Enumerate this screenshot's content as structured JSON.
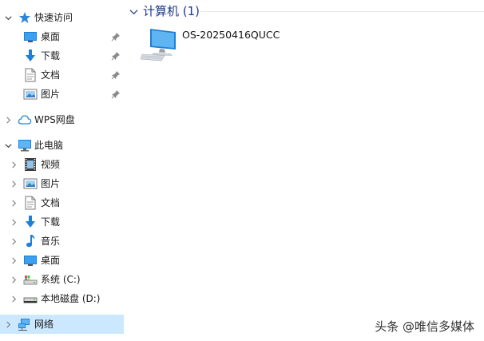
{
  "sidebar": {
    "quick_access": {
      "label": "快速访问",
      "items": [
        {
          "label": "桌面",
          "icon": "desktop-icon",
          "pinned": true
        },
        {
          "label": "下载",
          "icon": "download-icon",
          "pinned": true
        },
        {
          "label": "文档",
          "icon": "document-icon",
          "pinned": true
        },
        {
          "label": "图片",
          "icon": "picture-icon",
          "pinned": true
        }
      ]
    },
    "wps": {
      "label": "WPS网盘"
    },
    "this_pc": {
      "label": "此电脑",
      "items": [
        {
          "label": "视频",
          "icon": "video-icon"
        },
        {
          "label": "图片",
          "icon": "picture-icon"
        },
        {
          "label": "文档",
          "icon": "document-icon"
        },
        {
          "label": "下载",
          "icon": "download-icon"
        },
        {
          "label": "音乐",
          "icon": "music-icon"
        },
        {
          "label": "桌面",
          "icon": "desktop-icon"
        },
        {
          "label": "系统 (C:)",
          "icon": "system-drive-icon"
        },
        {
          "label": "本地磁盘 (D:)",
          "icon": "local-drive-icon"
        }
      ]
    },
    "network": {
      "label": "网络",
      "selected": true
    }
  },
  "main": {
    "group": {
      "title": "计算机 (1)",
      "items": [
        {
          "name": "OS-20250416QUCC",
          "icon": "computer-icon"
        }
      ]
    }
  },
  "watermark": "头条 @唯信多媒体",
  "colors": {
    "selection": "#cce8ff",
    "group_title": "#1e3a8a",
    "accent_blue": "#1e7fd8"
  }
}
